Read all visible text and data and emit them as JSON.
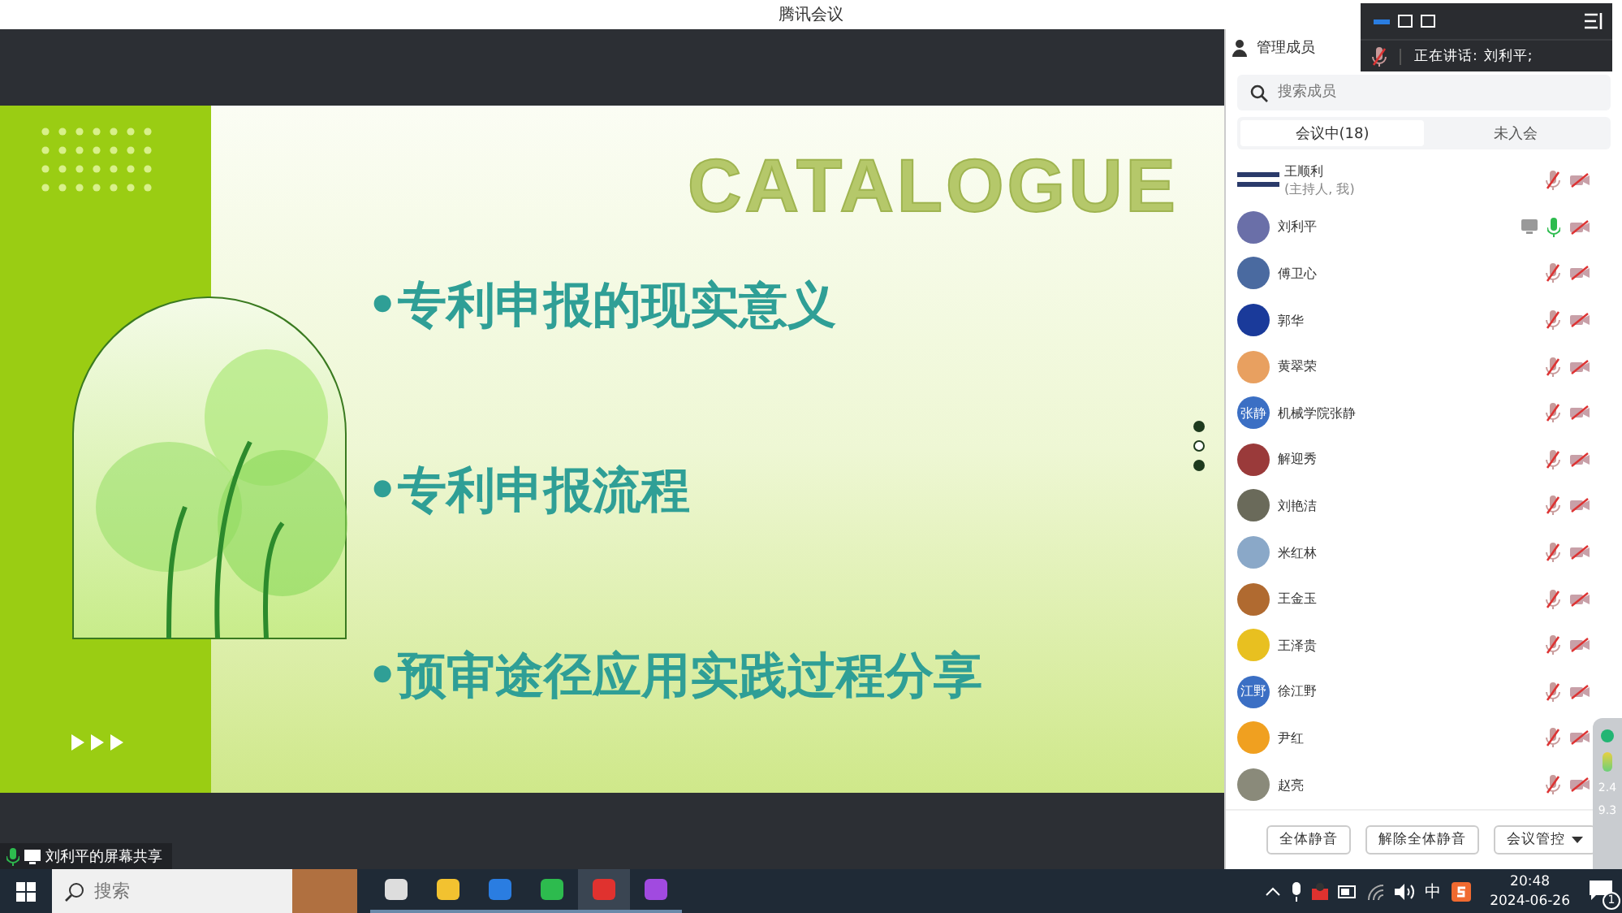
{
  "window": {
    "title": "腾讯会议"
  },
  "slide": {
    "watermark": "CATALOGUE",
    "bullets": [
      "•专利申报的现实意义",
      "•专利申报流程",
      "•预审途径应用实践过程分享"
    ],
    "page_dots": [
      {
        "selected": false
      },
      {
        "selected": true
      },
      {
        "selected": false
      }
    ]
  },
  "share_label": "刘利平的屏幕共享",
  "speaker_popup": {
    "layouts": [
      {
        "selected": true
      },
      {
        "selected": false
      },
      {
        "selected": false
      }
    ],
    "speaking_label": "正在讲话:",
    "speaker": "刘利平;"
  },
  "panel": {
    "title": "管理成员",
    "search": {
      "placeholder": "搜索成员"
    },
    "tabs": [
      {
        "label": "会议中(18)",
        "selected": true
      },
      {
        "label": "未入会",
        "selected": false
      }
    ],
    "members": [
      {
        "name": "王顺利",
        "note": "(主持人, 我)",
        "avatar": {
          "kind": "logo"
        },
        "mic_on": false,
        "sharing": false
      },
      {
        "name": "刘利平",
        "avatar": {
          "kind": "photo",
          "color": "#6a6fa8"
        },
        "mic_on": true,
        "sharing": true
      },
      {
        "name": "傅卫心",
        "avatar": {
          "kind": "photo",
          "color": "#4a6aa0"
        },
        "mic_on": false,
        "sharing": false
      },
      {
        "name": "郭华",
        "avatar": {
          "kind": "photo",
          "color": "#1a3a9a"
        },
        "mic_on": false,
        "sharing": false
      },
      {
        "name": "黄翠荣",
        "avatar": {
          "kind": "photo",
          "color": "#e8a060"
        },
        "mic_on": false,
        "sharing": false
      },
      {
        "name": "机械学院张静",
        "avatar": {
          "kind": "text",
          "text": "张静",
          "color": "#3b6fc4"
        },
        "mic_on": false,
        "sharing": false
      },
      {
        "name": "解迎秀",
        "avatar": {
          "kind": "photo",
          "color": "#9a3a3a"
        },
        "mic_on": false,
        "sharing": false
      },
      {
        "name": "刘艳洁",
        "avatar": {
          "kind": "photo",
          "color": "#6a6a5a"
        },
        "mic_on": false,
        "sharing": false
      },
      {
        "name": "米红林",
        "avatar": {
          "kind": "photo",
          "color": "#8aa8c8"
        },
        "mic_on": false,
        "sharing": false
      },
      {
        "name": "王金玉",
        "avatar": {
          "kind": "photo",
          "color": "#b06a30"
        },
        "mic_on": false,
        "sharing": false
      },
      {
        "name": "王泽贵",
        "avatar": {
          "kind": "photo",
          "color": "#e8c020"
        },
        "mic_on": false,
        "sharing": false
      },
      {
        "name": "徐江野",
        "avatar": {
          "kind": "text",
          "text": "江野",
          "color": "#3b6fc4"
        },
        "mic_on": false,
        "sharing": false
      },
      {
        "name": "尹红",
        "avatar": {
          "kind": "photo",
          "color": "#f0a020"
        },
        "mic_on": false,
        "sharing": false
      },
      {
        "name": "赵亮",
        "avatar": {
          "kind": "photo",
          "color": "#8a8a7a"
        },
        "mic_on": false,
        "sharing": false
      }
    ],
    "buttons": [
      {
        "label": "全体静音",
        "dropdown": false
      },
      {
        "label": "解除全体静音",
        "dropdown": false
      },
      {
        "label": "会议管控",
        "dropdown": true
      }
    ]
  },
  "side_widget": {
    "readings": [
      "2.4",
      "9.3"
    ]
  },
  "taskbar": {
    "search": {
      "placeholder": "搜索"
    },
    "apps": [
      {
        "kind": "task-view",
        "active": false
      },
      {
        "kind": "folder",
        "active": false
      },
      {
        "kind": "meeting",
        "active": false
      },
      {
        "kind": "chat",
        "active": false
      },
      {
        "kind": "office",
        "active": true
      },
      {
        "kind": "art",
        "active": false
      }
    ],
    "ime": "中",
    "time": "20:48",
    "date": "2024-06-26",
    "notification_count": "1"
  }
}
